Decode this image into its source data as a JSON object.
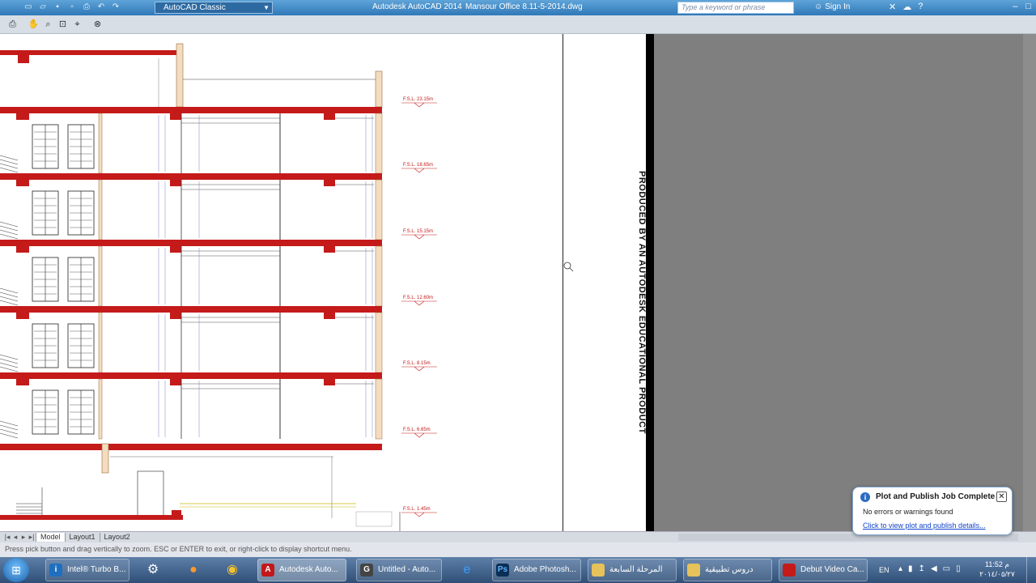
{
  "titlebar": {
    "workspace": "AutoCAD Classic",
    "app_title": "Autodesk AutoCAD 2014",
    "doc_title": "Mansour Office 8.11-5-2014.dwg",
    "search_placeholder": "Type a keyword or phrase",
    "signin": "Sign In"
  },
  "drawing": {
    "edu_stamp": "PRODUCED BY AN AUTODESK EDUCATIONAL PRODUCT",
    "level_labels": [
      "F.S.L.  23.15m",
      "F.S.L.  18.65m",
      "F.S.L.  15.15m",
      "F.S.L.  12.60m",
      "F.S.L.   8.15m",
      "F.S.L.   6.65m",
      "F.S.L.  1.45m"
    ]
  },
  "layout_tabs": [
    "Model",
    "Layout1",
    "Layout2"
  ],
  "command_line": "Press pick button and drag vertically to zoom.  ESC or ENTER to exit, or right-click to display shortcut menu.",
  "notification": {
    "title": "Plot and Publish Job Complete",
    "message": "No errors or warnings found",
    "link": "Click to view plot and publish details..."
  },
  "taskbar": {
    "items": [
      {
        "label": "Intel® Turbo B...",
        "icon": "intel-icon"
      },
      {
        "label": "Autodesk Auto...",
        "icon": "autocad-icon"
      },
      {
        "label": "Untitled - Auto...",
        "icon": "autocad-web-icon"
      },
      {
        "label": "Adobe Photosh...",
        "icon": "photoshop-icon"
      },
      {
        "label": "المرحلة السابعة",
        "icon": "folder-icon"
      },
      {
        "label": "دروس تطبيقية",
        "icon": "folder-icon"
      },
      {
        "label": "Debut Video Ca...",
        "icon": "debut-icon"
      }
    ],
    "language": "EN",
    "time": "11:52 م",
    "date": "٢٠١٤/٠٥/٢٧"
  },
  "colors": {
    "titlebar": "#2f78b8",
    "slab": "#c41a1a",
    "paper": "#ffffff",
    "background": "#7f7f7f"
  }
}
